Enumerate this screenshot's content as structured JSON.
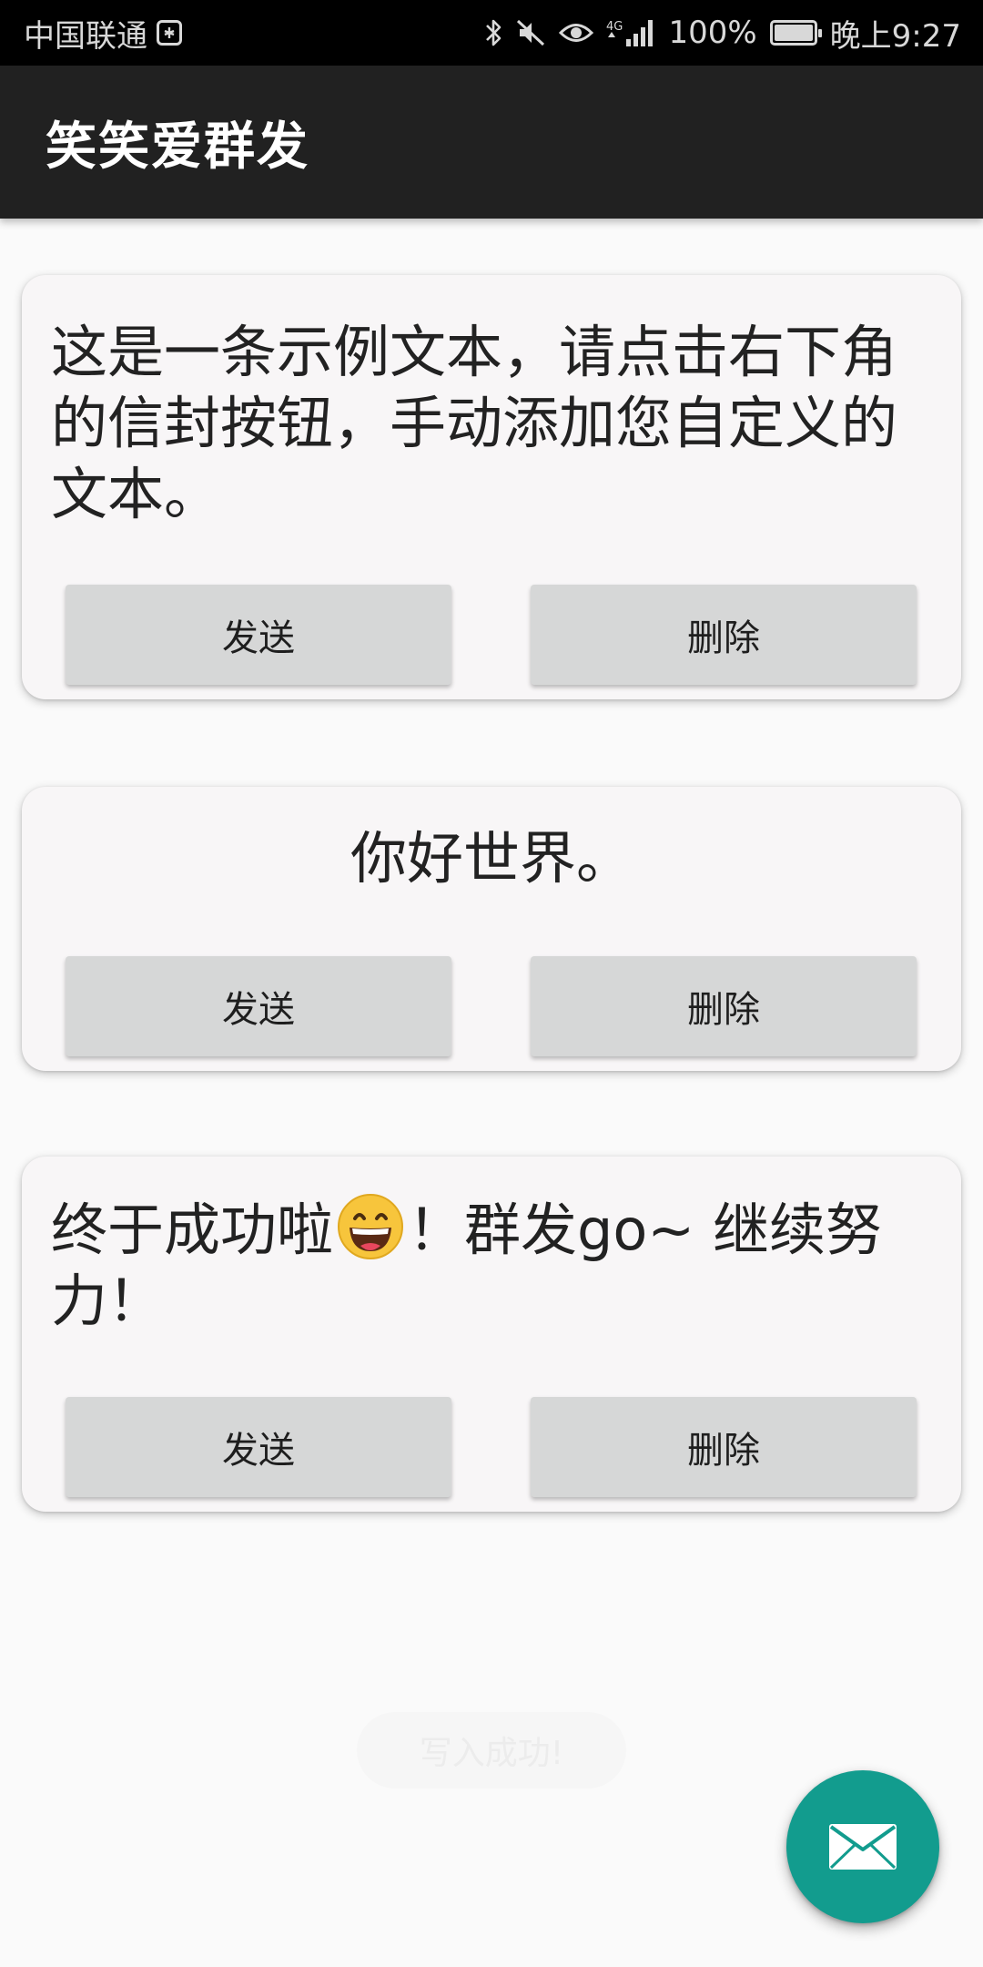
{
  "status_bar": {
    "carrier": "中国联通",
    "network_type": "4G",
    "battery_percent_text": "100%",
    "battery_level": 1.0,
    "time": "晚上9:27",
    "icons": [
      "carrier-badge-icon",
      "bluetooth-icon",
      "mute-icon",
      "eye-comfort-icon",
      "signal-icon",
      "battery-icon"
    ]
  },
  "app_bar": {
    "title": "笑笑爱群发"
  },
  "messages": [
    {
      "text": "这是一条示例文本，请点击右下角的信封按钮，手动添加您自定义的文本。",
      "send_label": "发送",
      "delete_label": "删除"
    },
    {
      "text": "你好世界。",
      "send_label": "发送",
      "delete_label": "删除"
    },
    {
      "text_before_emoji": "终于成功啦",
      "emoji": "grinning-face-emoji",
      "text_after_emoji": "！群发go~ 继续努力！",
      "send_label": "发送",
      "delete_label": "删除"
    }
  ],
  "toast": {
    "text": "写入成功!"
  },
  "fab": {
    "icon": "envelope-icon",
    "color": "#129c8e"
  },
  "colors": {
    "app_bar": "#212121",
    "status_bar": "#000000",
    "card": "#f8f6f7",
    "button": "#d6d7d7",
    "background": "#fafafa"
  }
}
